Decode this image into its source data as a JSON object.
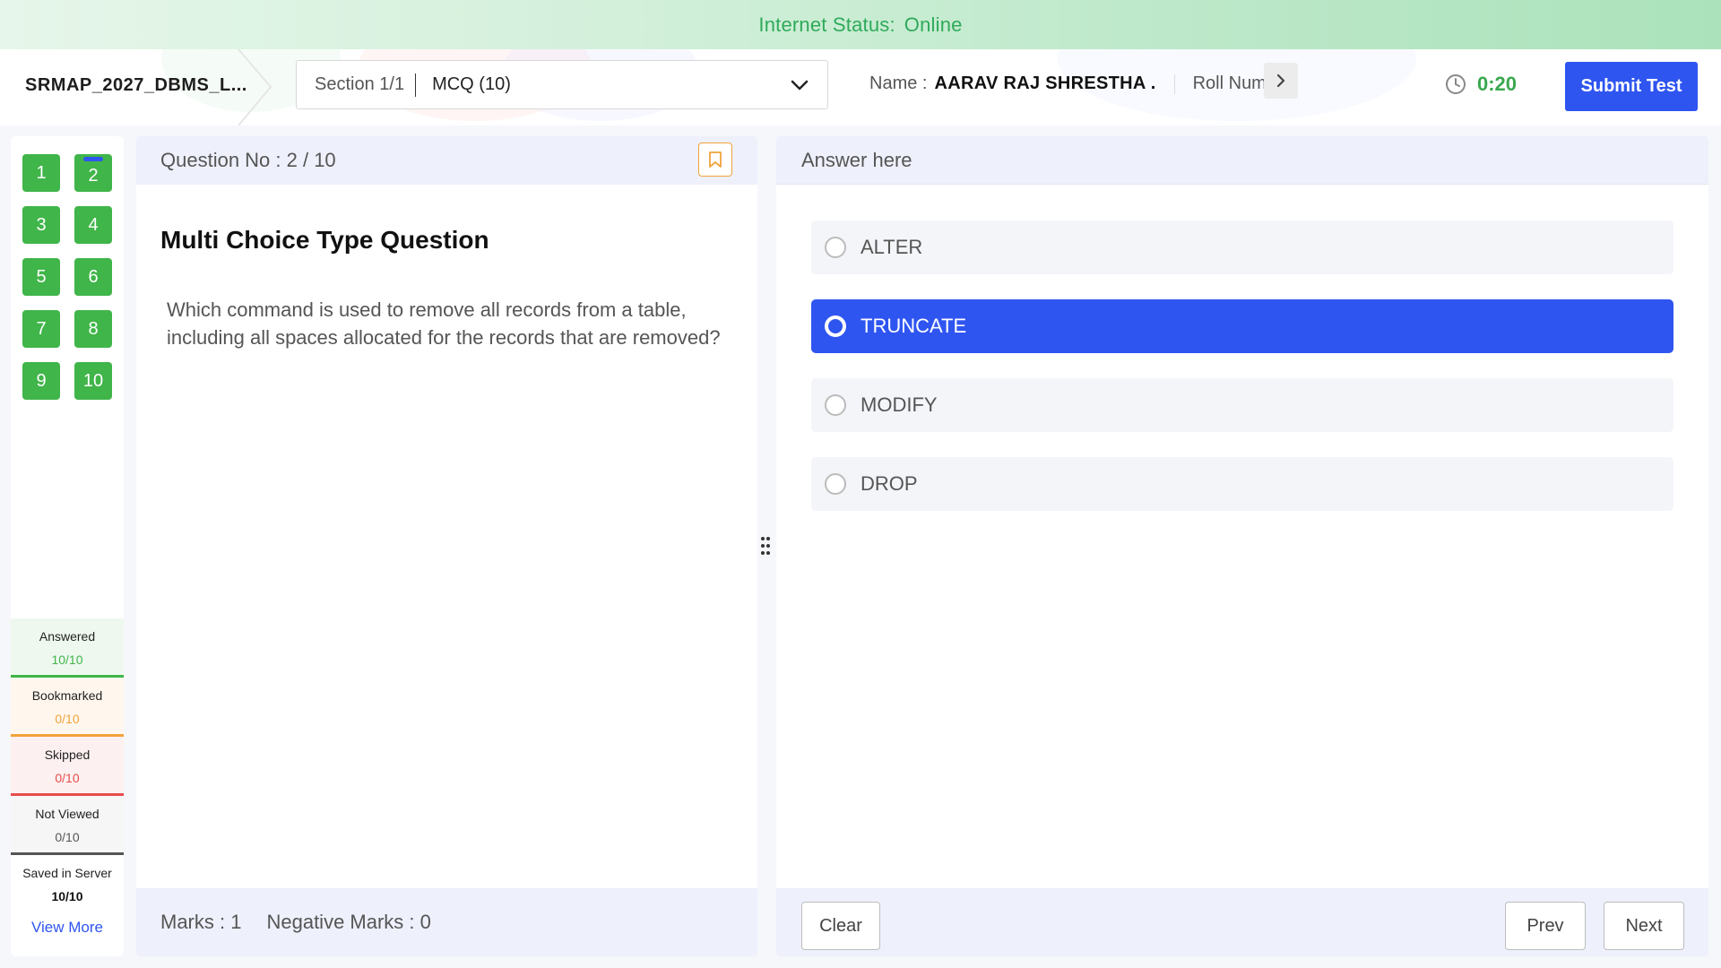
{
  "status_bar": {
    "label": "Internet Status:",
    "value": "Online"
  },
  "header": {
    "test_name": "SRMAP_2027_DBMS_L...",
    "section": {
      "label": "Section 1/1",
      "selected": "MCQ (10)"
    },
    "name_label": "Name :",
    "name_value": "AARAV RAJ SHRESTHA .",
    "roll_label": "Roll Number",
    "timer": "0:20",
    "submit_label": "Submit Test"
  },
  "sidebar": {
    "questions": [
      "1",
      "2",
      "3",
      "4",
      "5",
      "6",
      "7",
      "8",
      "9",
      "10"
    ],
    "current_question": "2",
    "legend": [
      {
        "label": "Answered",
        "count": "10/10",
        "color": "#40b549"
      },
      {
        "label": "Bookmarked",
        "count": "0/10",
        "color": "#f0a33a"
      },
      {
        "label": "Skipped",
        "count": "0/10",
        "color": "#e84c4c"
      },
      {
        "label": "Not Viewed",
        "count": "0/10",
        "color": "#555555"
      },
      {
        "label": "Saved in Server",
        "count": "10/10",
        "color": "#111111"
      }
    ],
    "view_more": "View More"
  },
  "question": {
    "number_label": "Question No : 2 / 10",
    "type": "Multi Choice Type Question",
    "text": "Which command is used to remove all records from a table, including all spaces allocated for the records that are removed?",
    "marks": "Marks : 1",
    "negative_marks": "Negative Marks : 0"
  },
  "answer": {
    "header": "Answer here",
    "options": [
      "ALTER",
      "TRUNCATE",
      "MODIFY",
      "DROP"
    ],
    "selected": "TRUNCATE",
    "clear_label": "Clear",
    "prev_label": "Prev",
    "next_label": "Next"
  },
  "colors": {
    "accent": "#2f55f0",
    "answered": "#40b549",
    "online": "#2faa5a",
    "bookmark": "#f0a33a"
  }
}
